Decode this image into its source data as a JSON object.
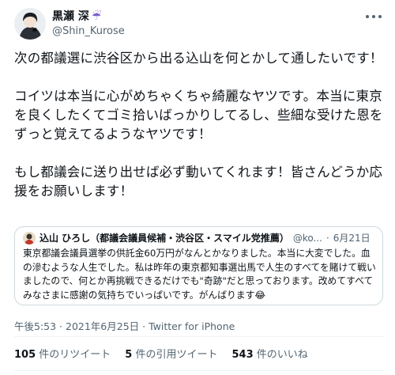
{
  "author": {
    "display_name": "黒瀬 深",
    "name_emoji": "☔",
    "handle": "@Shin_Kurose"
  },
  "tweet": {
    "paragraphs": [
      "次の都議選に渋谷区から出る込山を何とかして通したいです！",
      "コイツは本当に心がめちゃくちゃ綺麗なヤツです。本当に東京を良くしたくてゴミ拾いばっかりしてるし、些細な受けた恩をずっと覚えてるようなヤツです！",
      "もし都議会に送り出せば必ず動いてくれます！皆さんどうか応援をお願いします！"
    ]
  },
  "quoted_tweet": {
    "display_name": "込山 ひろし（都議会議員候補・渋谷区・スマイル党推薦）",
    "handle": "@ko...",
    "separator": "·",
    "date": "6月21日",
    "text": "東京都議会議員選挙の供託金60万円がなんとかなりました。本当に大変でした。血の滲むような人生でした。私は昨年の東京都知事選出馬で人生のすべてを賭けて戦いましたので、何とか再挑戦できるだけでも\"奇跡\"だと思っております。改めてすべてみなさまに感謝の気持ちでいっぱいです。がんばります😂"
  },
  "timestamp": "午後5:53 · 2021年6月25日 · Twitter for iPhone",
  "stats": {
    "retweets_count": "105",
    "retweets_label": "件のリツイート",
    "quotes_count": "5",
    "quotes_label": "件の引用ツイート",
    "likes_count": "543",
    "likes_label": "件のいいね"
  }
}
